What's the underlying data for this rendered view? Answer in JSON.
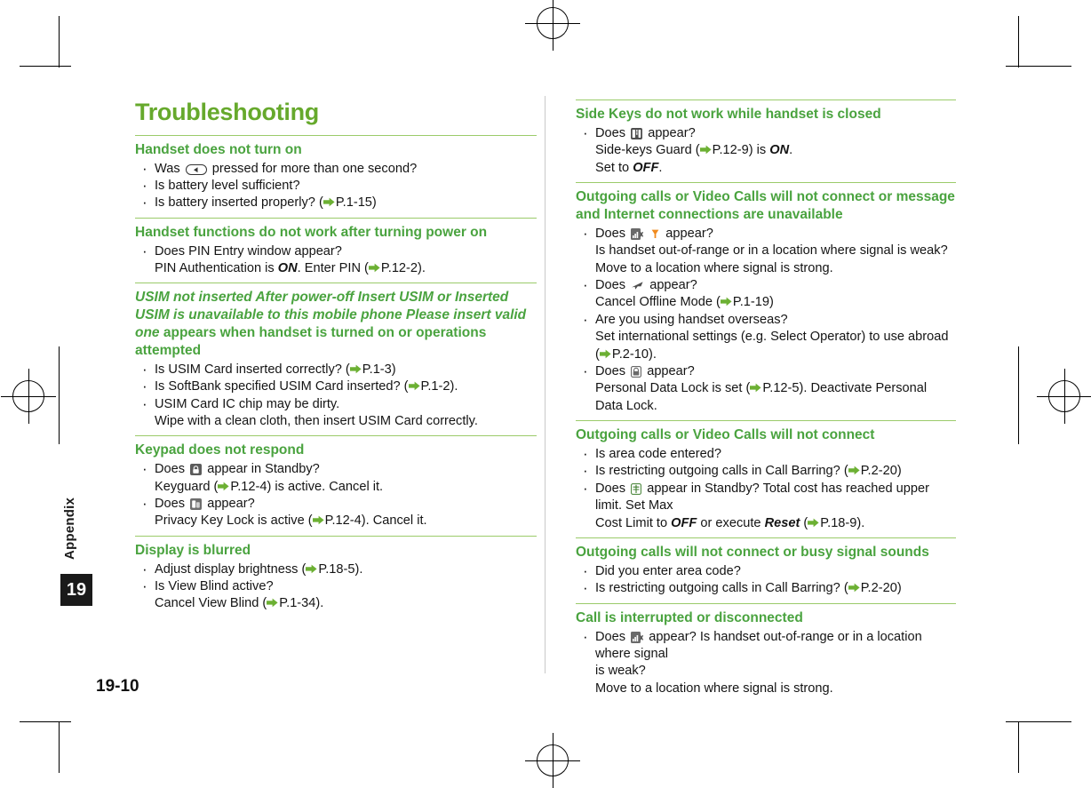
{
  "document": {
    "title": "Troubleshooting",
    "page_number": "19-10",
    "side_tab_label": "Appendix",
    "side_tab_number": "19",
    "accent_color": "#66a92c",
    "heading_color": "#4aa33f",
    "rule_color": "#9bcb6a"
  },
  "left_column": [
    {
      "heading": "Handset does not turn on",
      "heading_style": "normal",
      "items": [
        {
          "lines": [
            "Was [KEY] pressed for more than one second?"
          ]
        },
        {
          "lines": [
            "Is battery level sufficient?"
          ]
        },
        {
          "lines": [
            "Is battery inserted properly? ([REF]P.1-15)"
          ]
        }
      ]
    },
    {
      "heading": "Handset functions do not work after turning power on",
      "heading_style": "normal",
      "items": [
        {
          "lines": [
            "Does PIN Entry window appear?",
            "PIN Authentication is ON. Enter PIN ([REF]P.12-2)."
          ]
        }
      ]
    },
    {
      "heading": "USIM not inserted After power-off Insert USIM or Inserted USIM is unavailable to this mobile phone Please insert valid one appears when handset is turned on or operations attempted",
      "heading_style": "italic",
      "items": [
        {
          "lines": [
            "Is USIM Card inserted correctly? ([REF]P.1-3)"
          ]
        },
        {
          "lines": [
            "Is SoftBank specified USIM Card inserted? ([REF]P.1-2)."
          ]
        },
        {
          "lines": [
            "USIM Card IC chip may be dirty.",
            "Wipe with a clean cloth, then insert USIM Card correctly."
          ]
        }
      ]
    },
    {
      "heading": "Keypad does not respond",
      "heading_style": "normal",
      "items": [
        {
          "lines": [
            "Does [ICON] appear in Standby?",
            "Keyguard ([REF]P.12-4) is active. Cancel it."
          ]
        },
        {
          "lines": [
            "Does [ICON] appear?",
            "Privacy Key Lock is active ([REF]P.12-4). Cancel it."
          ]
        }
      ]
    },
    {
      "heading": "Display is blurred",
      "heading_style": "normal",
      "items": [
        {
          "lines": [
            " Adjust display brightness ([REF]P.18-5)."
          ]
        },
        {
          "lines": [
            "Is View Blind active?",
            "Cancel View Blind ([REF]P.1-34)."
          ]
        }
      ]
    }
  ],
  "right_column": [
    {
      "heading": "Side Keys do not work while handset is closed",
      "heading_style": "normal",
      "items": [
        {
          "lines": [
            "Does [ICON] appear?",
            "Side-keys Guard ([REF]P.12-9) is ON.",
            "Set to OFF."
          ]
        }
      ]
    },
    {
      "heading": "Outgoing calls or Video Calls will not connect or message and Internet connections are unavailable",
      "heading_style": "normal",
      "items": [
        {
          "lines": [
            "Does [ICON] [ICON] appear?",
            "Is handset out-of-range or in a location where signal is weak?",
            "Move to a location where signal is strong."
          ]
        },
        {
          "lines": [
            "Does [ICON] appear?",
            "Cancel Offline Mode ([REF]P.1-19)"
          ]
        },
        {
          "lines": [
            "Are you using handset overseas?",
            "Set international settings (e.g. Select Operator) to use abroad",
            "([REF]P.2-10)."
          ]
        },
        {
          "lines": [
            "Does [ICON] appear?",
            "Personal Data Lock is set ([REF]P.12-5). Deactivate Personal Data Lock."
          ]
        }
      ]
    },
    {
      "heading": "Outgoing calls or Video Calls will not connect",
      "heading_style": "normal",
      "items": [
        {
          "lines": [
            "Is area code entered?"
          ]
        },
        {
          "lines": [
            "Is restricting outgoing calls in Call Barring? ([REF]P.2-20)"
          ]
        },
        {
          "lines": [
            "Does [ICON] appear in Standby? Total cost has reached upper limit. Set Max",
            "Cost Limit to OFF or execute Reset ([REF]P.18-9)."
          ]
        }
      ]
    },
    {
      "heading": "Outgoing calls will not connect or busy signal sounds",
      "heading_style": "normal",
      "items": [
        {
          "lines": [
            "Did you enter area code?"
          ]
        },
        {
          "lines": [
            "Is restricting outgoing calls in Call Barring? ([REF]P.2-20)"
          ]
        }
      ]
    },
    {
      "heading": "Call is interrupted or disconnected",
      "heading_style": "normal",
      "items": [
        {
          "lines": [
            "Does [ICON] appear? Is handset out-of-range or in a location where signal",
            "is weak?",
            "Move to a location where signal is strong."
          ]
        }
      ]
    }
  ],
  "text": {
    "l1_h": "Handset does not turn on",
    "l1_i1a": "Was",
    "l1_i1b": "pressed for more than one second?",
    "l1_i2": "Is battery level sufficient?",
    "l1_i3a": "Is battery inserted properly? (",
    "l1_i3ref": "P.1-15)",
    "l2_h": "Handset functions do not work after turning power on",
    "l2_i1": "Does PIN Entry window appear?",
    "l2_i1b1": "PIN Authentication is ",
    "l2_i1b2": "ON",
    "l2_i1b3": ". Enter PIN (",
    "l2_i1ref": "P.12-2).",
    "l3_h1": "USIM not inserted After power-off Insert USIM or Inserted USIM is unavailable to this mobile phone Please insert valid one",
    "l3_h2": " appears when handset is turned on or operations attempted",
    "l3_i1a": "Is USIM Card inserted correctly? (",
    "l3_i1ref": "P.1-3)",
    "l3_i2a": "Is SoftBank specified USIM Card inserted? (",
    "l3_i2ref": "P.1-2).",
    "l3_i3": "USIM Card IC chip may be dirty.",
    "l3_i3b": "Wipe with a clean cloth, then insert USIM Card correctly.",
    "l4_h": "Keypad does not respond",
    "l4_i1a": "Does",
    "l4_i1b": "appear in Standby?",
    "l4_i1c": "Keyguard (",
    "l4_i1ref": "P.12-4)",
    "l4_i1d": " is active. Cancel it.",
    "l4_i2a": "Does",
    "l4_i2b": "appear?",
    "l4_i2c": "Privacy Key Lock is active (",
    "l4_i2ref": "P.12-4)",
    "l4_i2d": ". Cancel it.",
    "l5_h": "Display is blurred",
    "l5_i1a": " Adjust display brightness (",
    "l5_i1ref": "P.18-5).",
    "l5_i2": "Is View Blind active?",
    "l5_i2b": "Cancel View Blind (",
    "l5_i2ref": "P.1-34).",
    "r1_h": "Side Keys do not work while handset is closed",
    "r1_i1a": "Does",
    "r1_i1b": "appear?",
    "r1_i1c": "Side-keys Guard (",
    "r1_i1ref": "P.12-9)",
    "r1_i1d": " is ",
    "r1_i1e": "ON",
    "r1_i1f": ".",
    "r1_i1g": "Set to ",
    "r1_i1h": "OFF",
    "r1_i1i": ".",
    "r2_h": "Outgoing calls or Video Calls will not connect or message and Internet connections are unavailable",
    "r2_i1a": "Does",
    "r2_i1b": "appear?",
    "r2_i1c": "Is handset out-of-range or in a location where signal is weak?",
    "r2_i1d": "Move to a location where signal is strong.",
    "r2_i2a": "Does",
    "r2_i2b": "appear?",
    "r2_i2c": "Cancel Offline Mode (",
    "r2_i2ref": "P.1-19)",
    "r2_i3a": "Are you using handset overseas?",
    "r2_i3b": "Set international settings (e.g. Select Operator) to use abroad",
    "r2_i3c": "(",
    "r2_i3ref": "P.2-10).",
    "r2_i4a": "Does",
    "r2_i4b": "appear?",
    "r2_i4c": "Personal Data Lock is set (",
    "r2_i4ref": "P.12-5)",
    "r2_i4d": ". Deactivate Personal Data Lock.",
    "r3_h": "Outgoing calls or Video Calls will not connect",
    "r3_i1": "Is area code entered?",
    "r3_i2a": "Is restricting outgoing calls in Call Barring? (",
    "r3_i2ref": "P.2-20)",
    "r3_i3a": "Does",
    "r3_i3b": "appear in Standby? Total cost has reached upper limit. Set Max",
    "r3_i3c": "Cost Limit to ",
    "r3_i3d": "OFF",
    "r3_i3e": " or execute ",
    "r3_i3f": "Reset",
    "r3_i3g": " (",
    "r3_i3ref": "P.18-9).",
    "r4_h": "Outgoing calls will not connect or busy signal sounds",
    "r4_i1": "Did you enter area code?",
    "r4_i2a": "Is restricting outgoing calls in Call Barring? (",
    "r4_i2ref": "P.2-20)",
    "r5_h": "Call is interrupted or disconnected",
    "r5_i1a": "Does",
    "r5_i1b": "appear? Is handset out-of-range or in a location where signal",
    "r5_i1c": "is weak?",
    "r5_i1d": "Move to a location where signal is strong."
  },
  "icons": {
    "power_key": "power-end-key",
    "keyguard": "keyguard-lock-icon",
    "privacy_key_lock": "privacy-key-lock-icon",
    "side_keys_guard": "side-keys-guard-icon",
    "out_of_range": "out-of-range-icon",
    "signal_bars": "signal-strength-icon",
    "offline_mode": "offline-mode-icon",
    "personal_data_lock": "personal-data-lock-icon",
    "max_cost_limit": "max-cost-limit-icon",
    "page_reference": "page-reference-arrow-icon"
  }
}
